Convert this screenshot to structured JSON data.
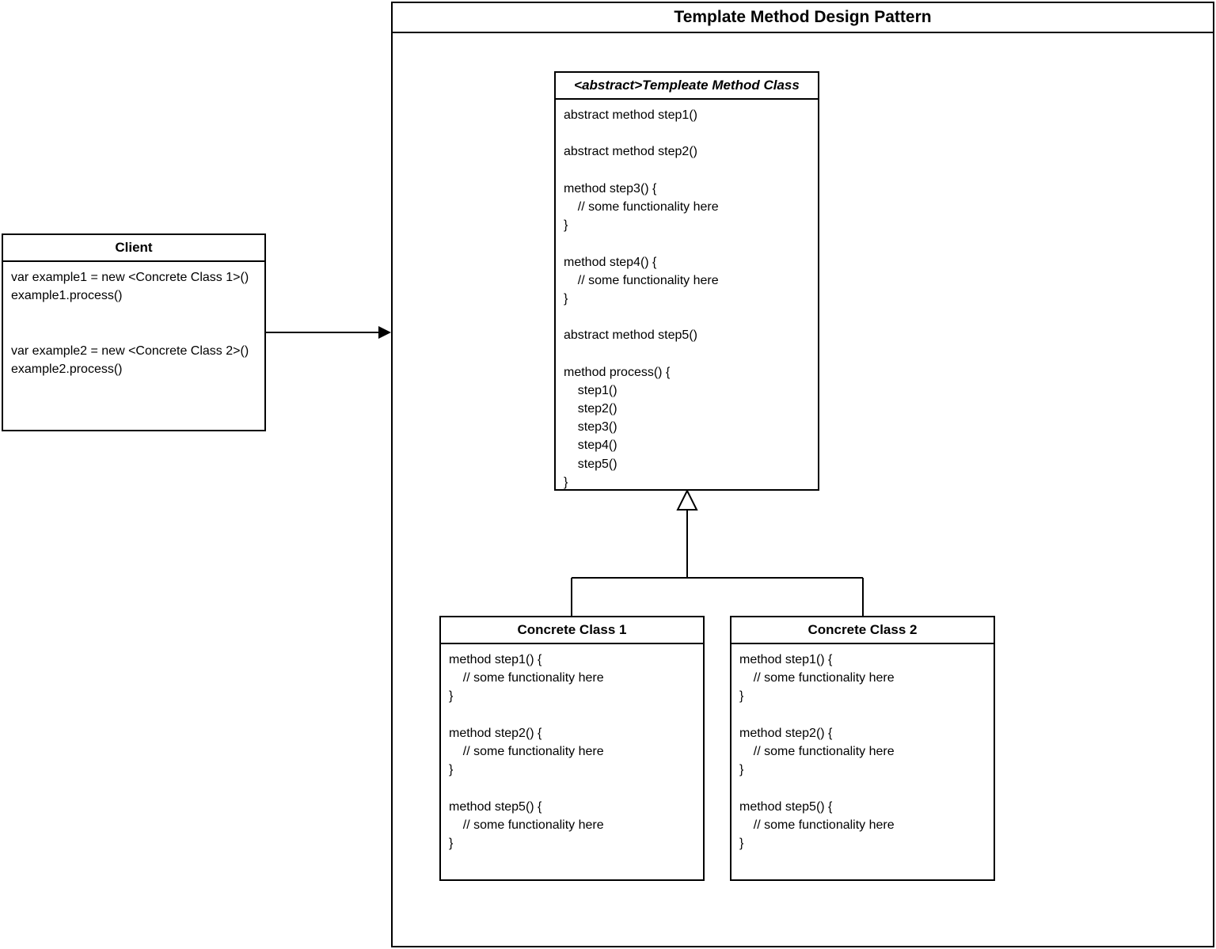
{
  "container": {
    "title": "Template Method Design Pattern"
  },
  "client": {
    "title": "Client",
    "body": "var example1 = new <Concrete Class 1>()\nexample1.process()\n\n\nvar example2 = new <Concrete Class 2>()\nexample2.process()"
  },
  "abstractClass": {
    "title": "<abstract>Templeate Method Class",
    "body": "abstract method step1()\n\nabstract method step2()\n\nmethod step3() {\n    // some functionality here\n}\n\nmethod step4() {\n    // some functionality here\n}\n\nabstract method step5()\n\nmethod process() {\n    step1()\n    step2()\n    step3()\n    step4()\n    step5()\n}"
  },
  "concrete1": {
    "title": "Concrete Class 1",
    "body": "method step1() {\n    // some functionality here\n}\n\nmethod step2() {\n    // some functionality here\n}\n\nmethod step5() {\n    // some functionality here\n}"
  },
  "concrete2": {
    "title": "Concrete Class 2",
    "body": "method step1() {\n    // some functionality here\n}\n\nmethod step2() {\n    // some functionality here\n}\n\nmethod step5() {\n    // some functionality here\n}"
  }
}
